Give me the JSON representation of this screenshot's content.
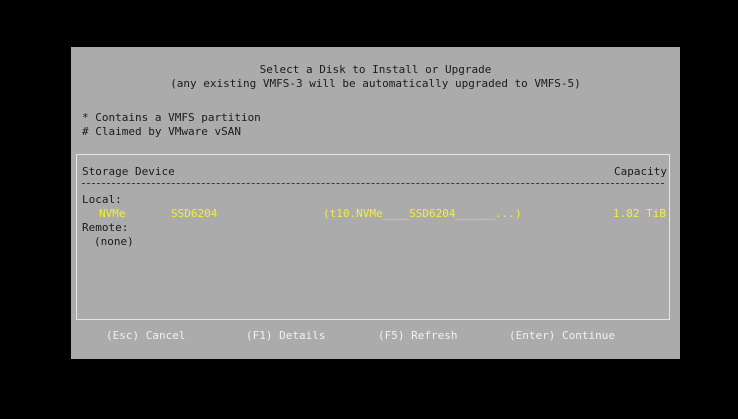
{
  "dialog": {
    "title": "Select a Disk to Install or Upgrade",
    "subtitle": "(any existing VMFS-3 will be automatically upgraded to VMFS-5)",
    "legend": [
      "* Contains a VMFS partition",
      "# Claimed by VMware vSAN"
    ]
  },
  "table": {
    "header_device": "Storage Device",
    "header_capacity": "Capacity",
    "local_label": "Local:",
    "disks": [
      {
        "name": "NVMe",
        "model": "SSD6204",
        "id": "(t10.NVMe____SSD6204______...)",
        "capacity": "1.82 TiB"
      }
    ],
    "remote_label": "Remote:",
    "remote_none": "(none)"
  },
  "footer": {
    "esc": "(Esc) Cancel",
    "f1": "(F1) Details",
    "f5": "(F5) Refresh",
    "enter": "(Enter) Continue"
  },
  "colors": {
    "background": "#000000",
    "dialog": "#ababab",
    "selected_text": "#f2ee3a",
    "footer_text": "#f0f0f0"
  }
}
